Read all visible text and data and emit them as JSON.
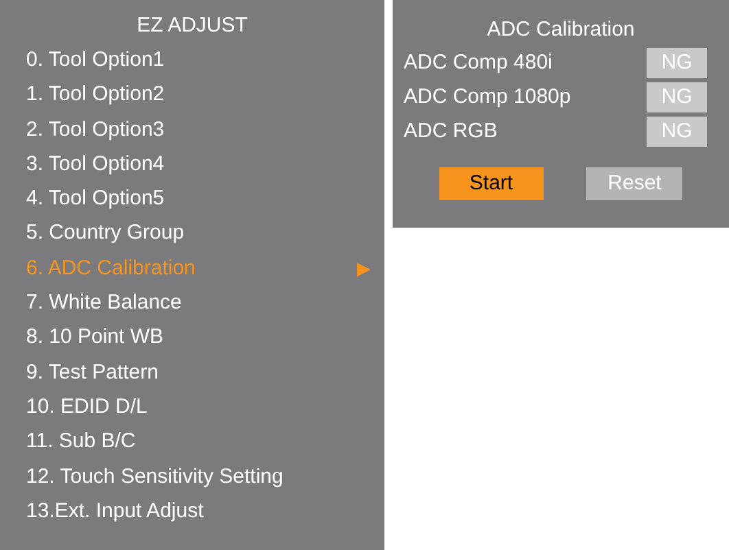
{
  "menu": {
    "title": "EZ ADJUST",
    "items": [
      {
        "label": "0. Tool Option1",
        "selected": false
      },
      {
        "label": "1. Tool Option2",
        "selected": false
      },
      {
        "label": "2. Tool Option3",
        "selected": false
      },
      {
        "label": "3. Tool Option4",
        "selected": false
      },
      {
        "label": "4. Tool Option5",
        "selected": false
      },
      {
        "label": "5. Country Group",
        "selected": false
      },
      {
        "label": "6. ADC Calibration",
        "selected": true,
        "arrow": "▶"
      },
      {
        "label": "7. White Balance",
        "selected": false
      },
      {
        "label": "8. 10 Point WB",
        "selected": false
      },
      {
        "label": "9. Test Pattern",
        "selected": false
      },
      {
        "label": "10. EDID D/L",
        "selected": false
      },
      {
        "label": "11. Sub B/C",
        "selected": false
      },
      {
        "label": "12. Touch Sensitivity Setting",
        "selected": false
      },
      {
        "label": "13.Ext. Input Adjust",
        "selected": false
      }
    ]
  },
  "panel": {
    "title": "ADC Calibration",
    "rows": [
      {
        "label": "ADC Comp 480i",
        "result": "NG"
      },
      {
        "label": "ADC Comp 1080p",
        "result": "NG"
      },
      {
        "label": "ADC RGB",
        "result": "NG"
      }
    ],
    "buttons": [
      {
        "label": "Start",
        "selected": true
      },
      {
        "label": "Reset",
        "selected": false
      }
    ]
  }
}
